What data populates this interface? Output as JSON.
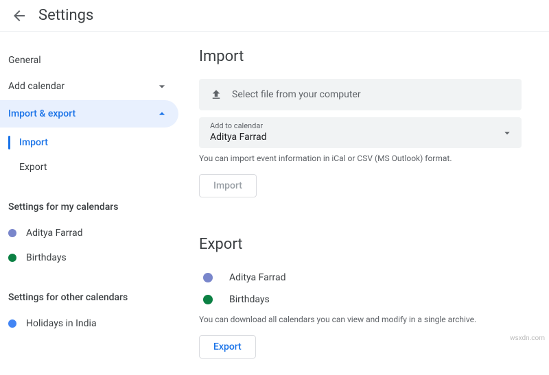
{
  "header": {
    "title": "Settings"
  },
  "sidebar": {
    "general": "General",
    "add_calendar": "Add calendar",
    "import_export": "Import & export",
    "sub": {
      "import": "Import",
      "export": "Export"
    },
    "my_calendars_header": "Settings for my calendars",
    "my_calendars": [
      {
        "label": "Aditya Farrad",
        "color": "#7986cb"
      },
      {
        "label": "Birthdays",
        "color": "#0b8043"
      }
    ],
    "other_calendars_header": "Settings for other calendars",
    "other_calendars": [
      {
        "label": "Holidays in India",
        "color": "#4285f4"
      }
    ]
  },
  "main": {
    "import": {
      "heading": "Import",
      "select_file": "Select file from your computer",
      "dropdown_label": "Add to calendar",
      "dropdown_value": "Aditya Farrad",
      "helper": "You can import event information in iCal or CSV (MS Outlook) format.",
      "button": "Import"
    },
    "export": {
      "heading": "Export",
      "calendars": [
        {
          "label": "Aditya Farrad",
          "color": "#7986cb"
        },
        {
          "label": "Birthdays",
          "color": "#0b8043"
        }
      ],
      "helper": "You can download all calendars you can view and modify in a single archive.",
      "button": "Export"
    }
  },
  "watermark": "wsxdn.com"
}
